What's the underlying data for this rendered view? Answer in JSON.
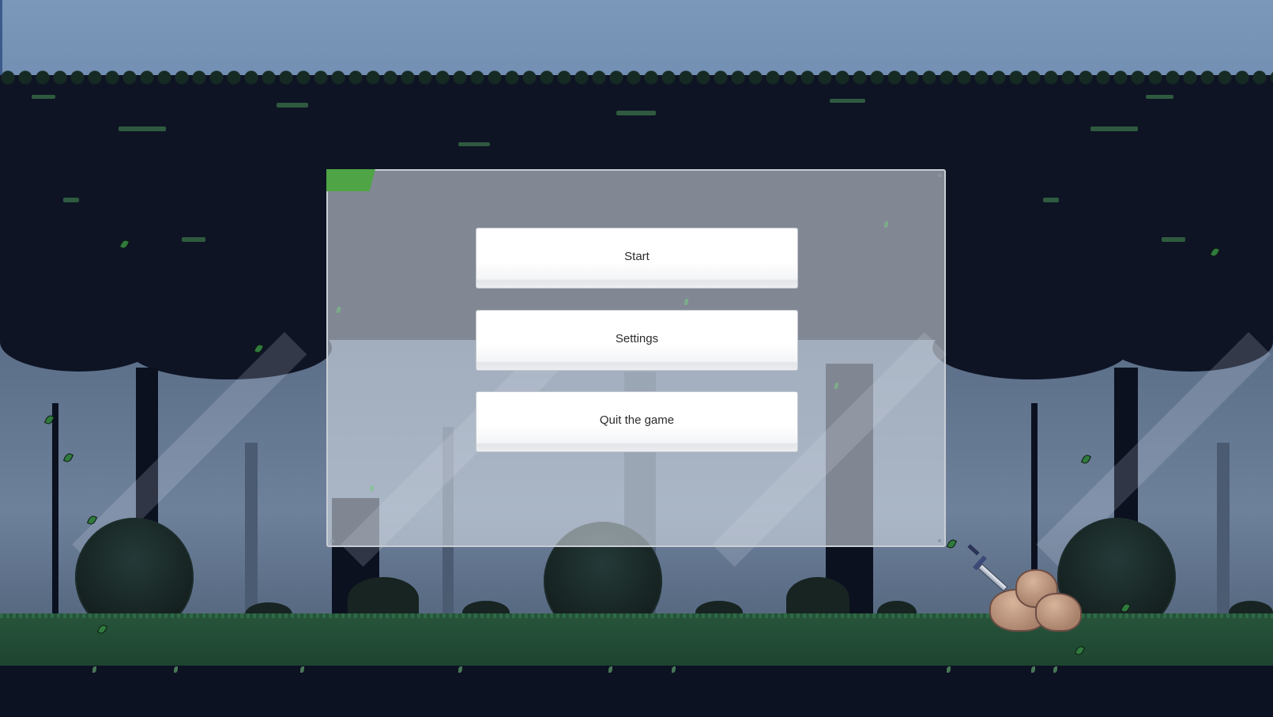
{
  "menu": {
    "buttons": [
      {
        "label": "Start"
      },
      {
        "label": "Settings"
      },
      {
        "label": "Quit the game"
      }
    ],
    "accent_color": "#4fa446"
  },
  "scene": {
    "theme": "pixel-art forest",
    "props": [
      "sword-in-rock-icon",
      "bush-icon",
      "tree-icon",
      "falling-leaf-icon"
    ]
  }
}
